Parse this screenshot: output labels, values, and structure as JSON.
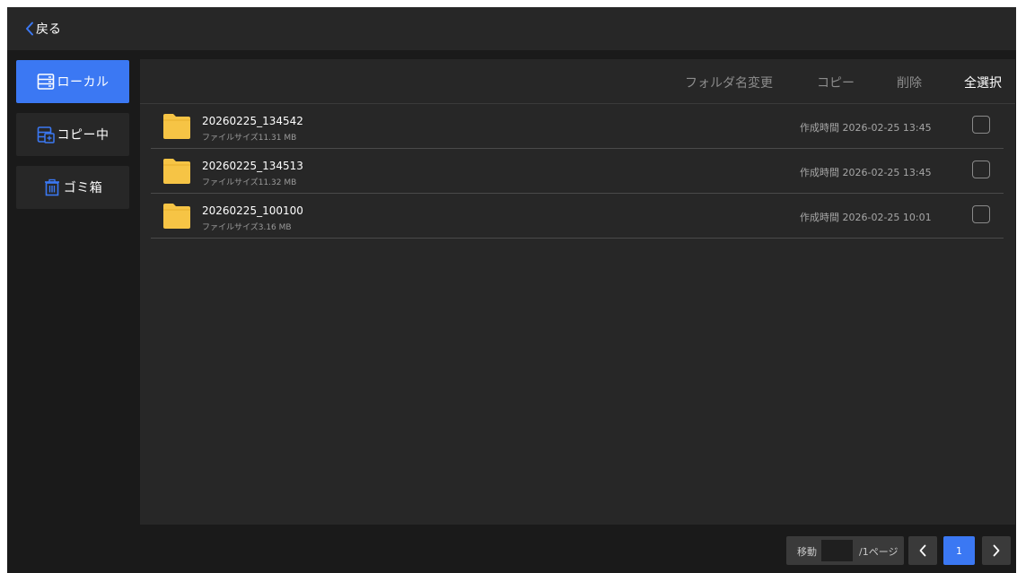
{
  "header": {
    "back_label": "戻る",
    "back_icon": "chevron-left-icon"
  },
  "sidebar": {
    "items": [
      {
        "label": "ローカル",
        "icon": "storage-icon",
        "active": true
      },
      {
        "label": "コピー中",
        "icon": "copy-storage-icon",
        "active": false
      },
      {
        "label": "ゴミ箱",
        "icon": "trash-icon",
        "active": false
      }
    ]
  },
  "toolbar": {
    "rename_label": "フォルダ名変更",
    "copy_label": "コピー",
    "delete_label": "削除",
    "select_all_label": "全選択"
  },
  "files": [
    {
      "name": "20260225_134542",
      "size": "ファイルサイズ11.31 MB",
      "created": "作成時間 2026-02-25 13:45",
      "checked": false
    },
    {
      "name": "20260225_134513",
      "size": "ファイルサイズ11.32 MB",
      "created": "作成時間 2026-02-25 13:45",
      "checked": false
    },
    {
      "name": "20260225_100100",
      "size": "ファイルサイズ3.16 MB",
      "created": "作成時間 2026-02-25 10:01",
      "checked": false
    }
  ],
  "pagination": {
    "goto_label": "移動",
    "goto_value": "",
    "page_suffix": "/1ページ",
    "current_page": "1"
  },
  "colors": {
    "accent": "#3b78f3",
    "background": "#1a1a1a",
    "panel": "#272727",
    "folder": "#f6c445"
  }
}
